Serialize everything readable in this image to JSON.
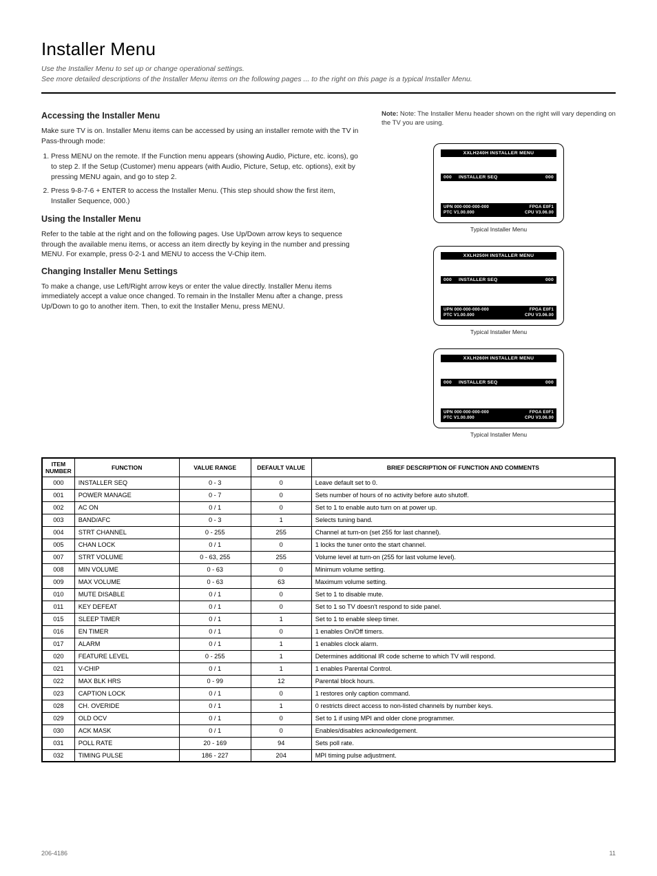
{
  "title": "Installer Menu",
  "subtitle_a": "Use the Installer Menu to set up or change operational settings.",
  "subtitle_b": "See more detailed descriptions of the Installer Menu items on the following pages ... to the right on this page is a typical Installer Menu.",
  "left": {
    "h1": "Accessing the Installer Menu",
    "p1": "Make sure TV is on. Installer Menu items can be accessed by using an installer remote with the TV in Pass-through mode:",
    "steps": [
      "Press MENU on the remote. If the Function menu appears (showing Audio, Picture, etc. icons), go to step 2. If the Setup (Customer) menu appears (with Audio, Picture, Setup, etc. options), exit by pressing MENU again, and go to step 2.",
      "Press 9-8-7-6 + ENTER to access the Installer Menu. (This step should show the first item, Installer Sequence, 000.)"
    ],
    "h2": "Using the Installer Menu",
    "p2a": "Refer to the table at the right and on the following pages. Use Up/Down arrow keys to sequence through the available menu items, or access an item directly by keying in the number and pressing MENU. For example, press 0-2-1 and MENU to access the V-Chip item.",
    "h3": "Changing Installer Menu Settings",
    "p3": "To make a change, use Left/Right arrow keys or enter the value directly. Installer Menu items immediately accept a value once changed. To remain in the Installer Menu after a change, press Up/Down to go to another item. Then, to exit the Installer Menu, press MENU.",
    "right_note": "Note: The Installer Menu header shown on the right will vary depending on the TV you are using."
  },
  "panels": [
    {
      "title": "XXLH240H INSTALLER  MENU",
      "seq_num": "000",
      "seq_label": "INSTALLER SEQ",
      "seq_val": "000",
      "upn": "UPN   000-000-000-000",
      "fpga": "FPGA E0F1",
      "ptc": "PTC V1.00.000",
      "cpu": "CPU V3.06.00",
      "caption": "Typical Installer Menu"
    },
    {
      "title": "XXLH250H INSTALLER  MENU",
      "seq_num": "000",
      "seq_label": "INSTALLER SEQ",
      "seq_val": "000",
      "upn": "UPN   000-000-000-000",
      "fpga": "FPGA E0F1",
      "ptc": "PTC V1.00.000",
      "cpu": "CPU V3.06.00",
      "caption": "Typical Installer Menu"
    },
    {
      "title": "XXLH260H INSTALLER  MENU",
      "seq_num": "000",
      "seq_label": "INSTALLER SEQ",
      "seq_val": "000",
      "upn": "UPN   000-000-000-000",
      "fpga": "FPGA E0F1",
      "ptc": "PTC V1.00.000",
      "cpu": "CPU V3.06.00",
      "caption": "Typical Installer Menu"
    }
  ],
  "table": {
    "headers": [
      "ITEM NUMBER",
      "FUNCTION",
      "VALUE RANGE",
      "DEFAULT VALUE",
      "BRIEF DESCRIPTION OF FUNCTION AND COMMENTS"
    ],
    "rows": [
      [
        "000",
        "INSTALLER SEQ",
        "0 - 3",
        "0",
        "Leave default set to 0."
      ],
      [
        "001",
        "POWER MANAGE",
        "0 - 7",
        "0",
        "Sets number of hours of no activity before auto shutoff."
      ],
      [
        "002",
        "AC ON",
        "0 / 1",
        "0",
        "Set to 1 to enable auto turn on at power up."
      ],
      [
        "003",
        "BAND/AFC",
        "0 - 3",
        "1",
        "Selects tuning band."
      ],
      [
        "004",
        "STRT CHANNEL",
        "0 - 255",
        "255",
        "Channel at turn-on (set 255 for last channel)."
      ],
      [
        "005",
        "CHAN LOCK",
        "0 / 1",
        "0",
        "1 locks the tuner onto the start channel."
      ],
      [
        "007",
        "STRT VOLUME",
        "0 - 63, 255",
        "255",
        "Volume level at turn-on (255 for last volume level)."
      ],
      [
        "008",
        "MIN VOLUME",
        "0 - 63",
        "0",
        "Minimum volume setting."
      ],
      [
        "009",
        "MAX VOLUME",
        "0 - 63",
        "63",
        "Maximum volume setting."
      ],
      [
        "010",
        "MUTE DISABLE",
        "0 / 1",
        "0",
        "Set to 1 to disable mute."
      ],
      [
        "011",
        "KEY DEFEAT",
        "0 / 1",
        "0",
        "Set to 1 so TV doesn't respond to side panel."
      ],
      [
        "015",
        "SLEEP TIMER",
        "0 / 1",
        "1",
        "Set to 1 to enable sleep timer."
      ],
      [
        "016",
        "EN TIMER",
        "0 / 1",
        "0",
        "1 enables On/Off timers."
      ],
      [
        "017",
        "ALARM",
        "0 / 1",
        "1",
        "1 enables clock alarm."
      ],
      [
        "020",
        "FEATURE LEVEL",
        "0 - 255",
        "1",
        "Determines additional IR code scheme to which TV will respond."
      ],
      [
        "021",
        "V-CHIP",
        "0 / 1",
        "1",
        "1 enables Parental Control."
      ],
      [
        "022",
        "MAX BLK HRS",
        "0 - 99",
        "12",
        "Parental block hours."
      ],
      [
        "023",
        "CAPTION LOCK",
        "0 / 1",
        "0",
        "1 restores only caption command."
      ],
      [
        "028",
        "CH. OVERIDE",
        "0 / 1",
        "1",
        "0 restricts direct access to non-listed channels by number keys."
      ],
      [
        "029",
        "OLD OCV",
        "0 / 1",
        "0",
        "Set to 1 if using MPI and older clone programmer."
      ],
      [
        "030",
        "ACK MASK",
        "0 / 1",
        "0",
        "Enables/disables acknowledgement."
      ],
      [
        "031",
        "POLL RATE",
        "20 - 169",
        "94",
        "Sets poll rate."
      ],
      [
        "032",
        "TIMING PULSE",
        "186 - 227",
        "204",
        "MPI timing pulse adjustment."
      ]
    ]
  },
  "footer": {
    "left": "206-4186",
    "right": "11"
  }
}
